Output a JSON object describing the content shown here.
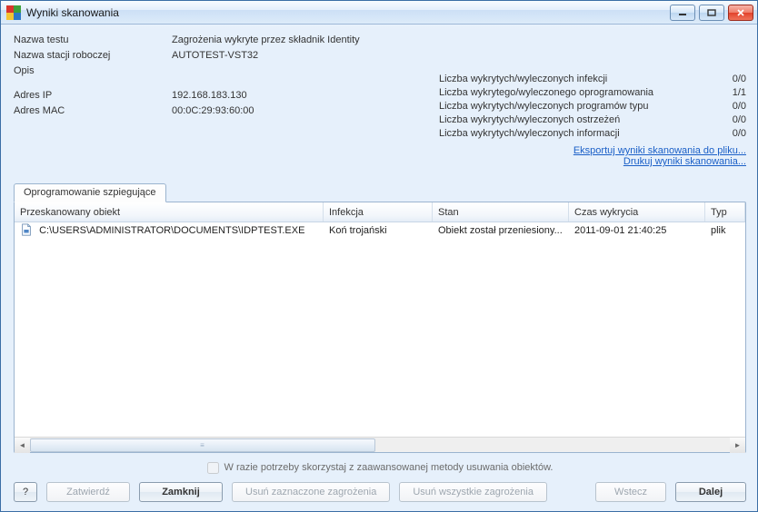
{
  "window": {
    "title": "Wyniki skanowania"
  },
  "info": {
    "labels": {
      "test_name": "Nazwa testu",
      "station_name": "Nazwa stacji roboczej",
      "description": "Opis",
      "ip": "Adres IP",
      "mac": "Adres MAC"
    },
    "values": {
      "test_name": "Zagrożenia wykryte przez składnik Identity",
      "station_name": "AUTOTEST-VST32",
      "description": "",
      "ip": "192.168.183.130",
      "mac": "00:0C:29:93:60:00"
    }
  },
  "stats": {
    "rows": [
      {
        "label": "Liczba wykrytych/wyleczonych infekcji",
        "value": "0/0"
      },
      {
        "label": "Liczba wykrytego/wyleczonego oprogramowania",
        "value": "1/1"
      },
      {
        "label": "Liczba wykrytych/wyleczonych programów typu",
        "value": "0/0"
      },
      {
        "label": "Liczba wykrytych/wyleczonych ostrzeżeń",
        "value": "0/0"
      },
      {
        "label": "Liczba wykrytych/wyleczonych informacji",
        "value": "0/0"
      }
    ],
    "links": {
      "export": "Eksportuj  wyniki skanowania do pliku...",
      "print": "Drukuj wyniki skanowania..."
    }
  },
  "tabs": {
    "spyware": "Oprogramowanie szpiegujące"
  },
  "table": {
    "headers": {
      "object": "Przeskanowany obiekt",
      "infection": "Infekcja",
      "status": "Stan",
      "detected_at": "Czas wykrycia",
      "type": "Typ"
    },
    "rows": [
      {
        "object": "C:\\USERS\\ADMINISTRATOR\\DOCUMENTS\\IDPTEST.EXE",
        "infection": "Koń trojański",
        "status": "Obiekt został przeniesiony...",
        "detected_at": "2011-09-01 21:40:25",
        "type": "plik"
      }
    ]
  },
  "footer": {
    "advanced_removal": "W razie potrzeby skorzystaj z zaawansowanej metody usuwania obiektów.",
    "buttons": {
      "help": "?",
      "approve": "Zatwierdź",
      "close": "Zamknij",
      "delete_selected": "Usuń zaznaczone zagrożenia",
      "delete_all": "Usuń wszystkie zagrożenia",
      "back": "Wstecz",
      "next": "Dalej"
    }
  },
  "icons": {
    "file": "file-icon",
    "app": "avg-icon"
  }
}
